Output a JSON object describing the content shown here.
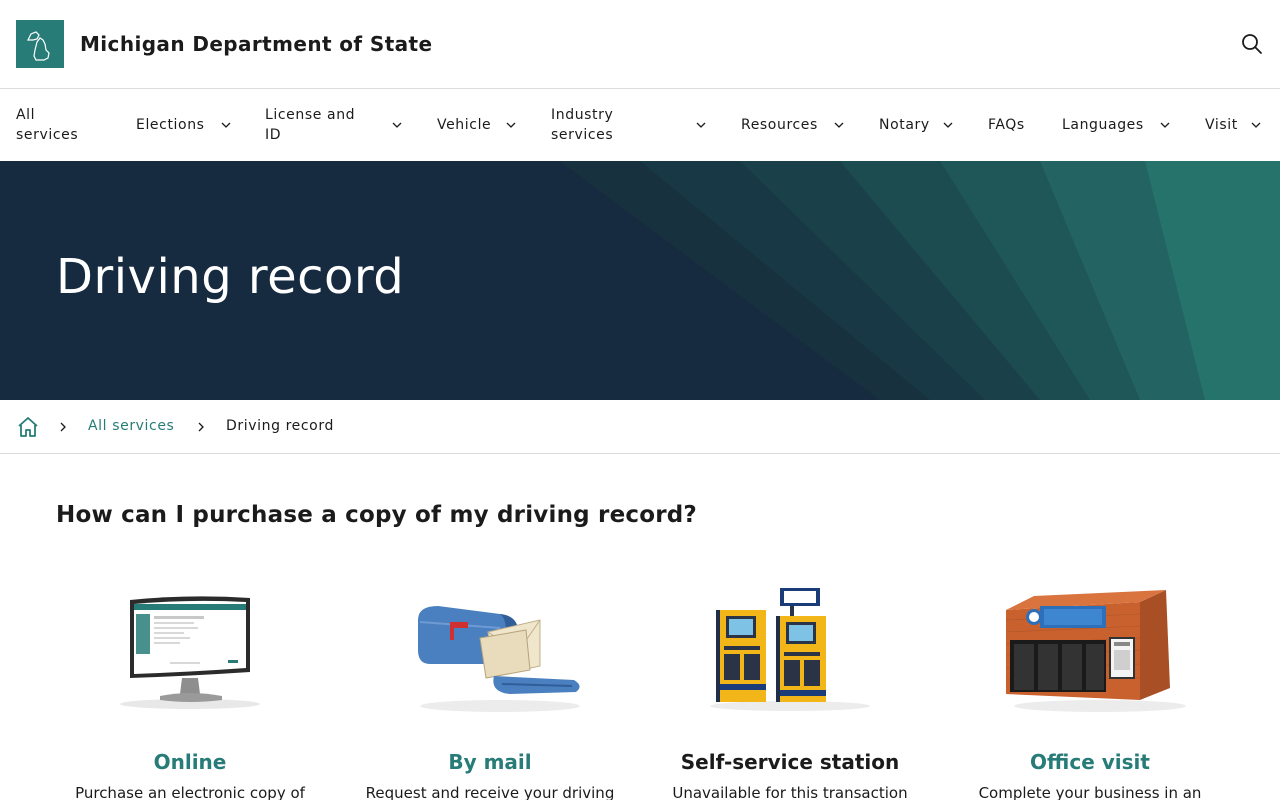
{
  "header": {
    "site_title": "Michigan Department of State",
    "logo_icon": "michigan-map-icon",
    "search_icon": "search-icon",
    "accent_color": "#277c78"
  },
  "nav": {
    "items": [
      {
        "label": "All services",
        "has_dropdown": false
      },
      {
        "label": "Elections",
        "has_dropdown": true
      },
      {
        "label": "License and ID",
        "has_dropdown": true
      },
      {
        "label": "Vehicle",
        "has_dropdown": true
      },
      {
        "label": "Industry services",
        "has_dropdown": true
      },
      {
        "label": "Resources",
        "has_dropdown": true
      },
      {
        "label": "Notary",
        "has_dropdown": true
      },
      {
        "label": "FAQs",
        "has_dropdown": false
      },
      {
        "label": "Languages",
        "has_dropdown": true
      },
      {
        "label": "Visit",
        "has_dropdown": true
      }
    ]
  },
  "hero": {
    "title": "Driving record",
    "background_color": "#162b40"
  },
  "breadcrumb": {
    "home_icon": "home-icon",
    "link": "All services",
    "current": "Driving record"
  },
  "main": {
    "heading": "How can I purchase a copy of my driving record?",
    "options": [
      {
        "title": "Online",
        "description": "Purchase an electronic copy of",
        "icon": "computer-monitor-icon",
        "is_link": true
      },
      {
        "title": "By mail",
        "description": "Request and receive your driving",
        "icon": "mailbox-icon",
        "is_link": true
      },
      {
        "title": "Self-service station",
        "description": "Unavailable for this transaction",
        "icon": "self-service-kiosk-icon",
        "is_link": false
      },
      {
        "title": "Office visit",
        "description": "Complete your business in an",
        "icon": "office-building-icon",
        "is_link": true
      }
    ]
  }
}
